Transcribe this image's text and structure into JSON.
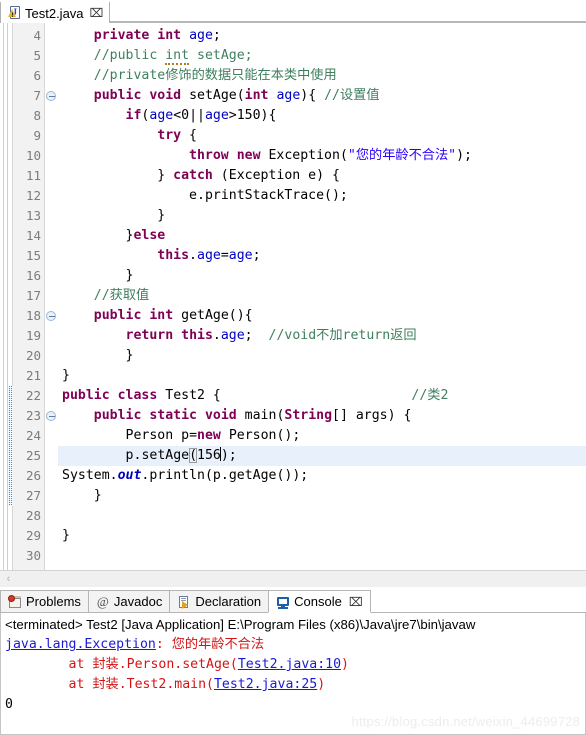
{
  "editor_tab": {
    "label": "Test2.java",
    "close_glyph": "⌧",
    "icon": "java-file-warning-icon"
  },
  "code": {
    "first_line_number": 4,
    "last_line_number": 30,
    "highlighted_line": 25,
    "change_bar_lines": [
      22,
      23,
      24,
      25,
      26,
      27
    ],
    "folding_lines": [
      7,
      18,
      23
    ],
    "lines": [
      {
        "n": 4,
        "text": "    private int age;"
      },
      {
        "n": 5,
        "text": "    //public int setAge;"
      },
      {
        "n": 6,
        "text": "    //private修饰的数据只能在本类中使用"
      },
      {
        "n": 7,
        "text": "    public void setAge(int age){ //设置值"
      },
      {
        "n": 8,
        "text": "        if(age<0||age>150){"
      },
      {
        "n": 9,
        "text": "            try {"
      },
      {
        "n": 10,
        "text": "                throw new Exception(\"您的年龄不合法\");"
      },
      {
        "n": 11,
        "text": "            } catch (Exception e) {"
      },
      {
        "n": 12,
        "text": "                e.printStackTrace();"
      },
      {
        "n": 13,
        "text": "            }"
      },
      {
        "n": 14,
        "text": "        }else"
      },
      {
        "n": 15,
        "text": "            this.age=age;"
      },
      {
        "n": 16,
        "text": "        }"
      },
      {
        "n": 17,
        "text": "    //获取值"
      },
      {
        "n": 18,
        "text": "    public int getAge(){"
      },
      {
        "n": 19,
        "text": "        return this.age;  //void不加return返回"
      },
      {
        "n": 20,
        "text": "        }"
      },
      {
        "n": 21,
        "text": "}"
      },
      {
        "n": 22,
        "text": "public class Test2 {                        //类2"
      },
      {
        "n": 23,
        "text": "    public static void main(String[] args) {"
      },
      {
        "n": 24,
        "text": "        Person p=new Person();"
      },
      {
        "n": 25,
        "text": "        p.setAge(156);"
      },
      {
        "n": 26,
        "text": "System.out.println(p.getAge());"
      },
      {
        "n": 27,
        "text": "    }"
      },
      {
        "n": 28,
        "text": ""
      },
      {
        "n": 29,
        "text": "}"
      },
      {
        "n": 30,
        "text": ""
      }
    ],
    "caret_line": 25,
    "caret_after_text": "156"
  },
  "view_tabs": [
    {
      "label": "Problems",
      "icon": "problems-icon",
      "active": false,
      "closeable": false
    },
    {
      "label": "Javadoc",
      "icon": "at-sign-icon",
      "active": false,
      "closeable": false
    },
    {
      "label": "Declaration",
      "icon": "declaration-icon",
      "active": false,
      "closeable": false
    },
    {
      "label": "Console",
      "icon": "console-icon",
      "active": true,
      "closeable": true,
      "close_glyph": "⌧"
    }
  ],
  "console": {
    "header": "<terminated> Test2 [Java Application] E:\\Program Files (x86)\\Java\\jre7\\bin\\javaw",
    "lines": [
      {
        "kind": "error",
        "segments": [
          {
            "text": "java.lang.Exception",
            "style": "link"
          },
          {
            "text": ": 您的年龄不合法",
            "style": "err"
          }
        ]
      },
      {
        "kind": "error",
        "segments": [
          {
            "text": "\tat 封装.Person.setAge(",
            "style": "err"
          },
          {
            "text": "Test2.java:10",
            "style": "link"
          },
          {
            "text": ")",
            "style": "err"
          }
        ]
      },
      {
        "kind": "error",
        "segments": [
          {
            "text": "\tat 封装.Test2.main(",
            "style": "err"
          },
          {
            "text": "Test2.java:25",
            "style": "link"
          },
          {
            "text": ")",
            "style": "err"
          }
        ]
      },
      {
        "kind": "stdout",
        "segments": [
          {
            "text": "0",
            "style": "out"
          }
        ]
      }
    ]
  },
  "scrollbar": {
    "left_arrow": "‹"
  },
  "watermark": "https://blog.csdn.net/weixin_44699728",
  "colors": {
    "keyword": "#7f0055",
    "comment": "#3f7f5f",
    "string": "#2a00ff",
    "field": "#0000c0",
    "error": "#d41515",
    "link": "#1a1ad4",
    "highlight_line": "#e8f1fb",
    "change_bar": "#3e8fd8"
  }
}
